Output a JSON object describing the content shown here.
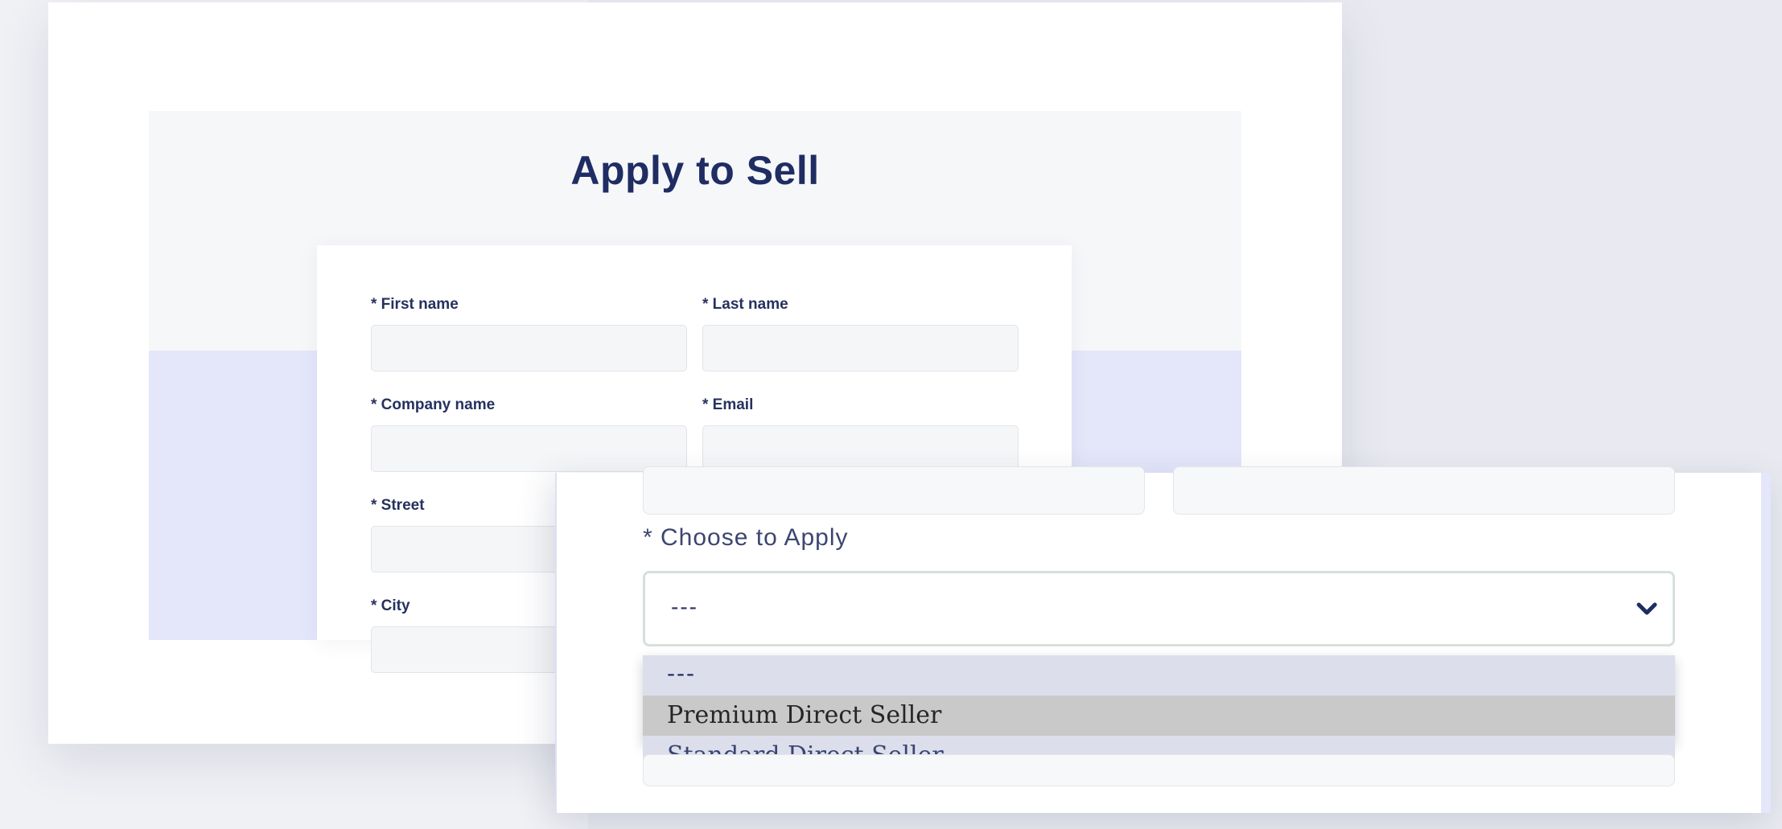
{
  "page": {
    "title": "Apply to Sell"
  },
  "form": {
    "first_name_label": "* First name",
    "last_name_label": "* Last name",
    "company_name_label": "* Company name",
    "email_label": "* Email",
    "street_label": "* Street",
    "city_label": "* City"
  },
  "zoom": {
    "choose_label": "* Choose to Apply",
    "select_value": "---",
    "options": [
      "---",
      "Premium Direct Seller",
      "Standard Direct Seller"
    ],
    "hovered_option": "Premium Direct Seller"
  },
  "colors": {
    "title": "#1f2d63",
    "hero_light": "#f6f7f9",
    "hero_lavender": "#e4e6fa",
    "option_hover": "#c9c9c9",
    "dropdown_bg": "#dcdfeb"
  },
  "icons": {
    "select_chevron": "chevron-down-icon"
  }
}
